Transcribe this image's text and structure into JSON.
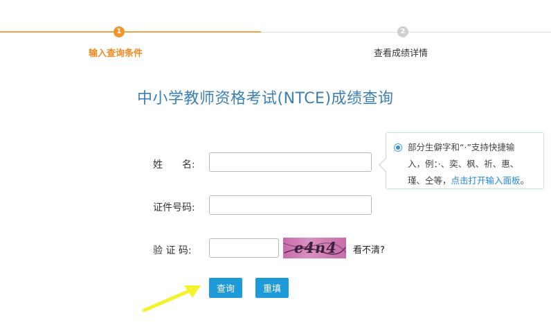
{
  "steps": {
    "step1": {
      "number": "1",
      "label": "输入查询条件"
    },
    "step2": {
      "number": "2",
      "label": "查看成绩详情"
    }
  },
  "page_title": "中小学教师资格考试(NTCE)成绩查询",
  "form": {
    "name_label": "姓　　名:",
    "name_value": "",
    "id_label": "证件号码:",
    "id_value": "",
    "captcha_label": "验 证 码:",
    "captcha_value": "",
    "captcha_image_text": "e4n4",
    "cant_see_label": "看不清?"
  },
  "tooltip": {
    "text_line1": "部分生僻字和“·”支持快捷输",
    "text_line2": "入，例：·、奕、枫、祈、惠、",
    "text_line3_prefix": "瑾、仝等，",
    "link_text": "点击打开输入面板",
    "text_line3_suffix": "。"
  },
  "buttons": {
    "query_label": "查询",
    "reset_label": "重填"
  },
  "colors": {
    "accent_orange": "#f0952a",
    "title_blue": "#3a7fb6",
    "button_blue": "#1f9ad8",
    "arrow_yellow": "#f4f22a"
  }
}
